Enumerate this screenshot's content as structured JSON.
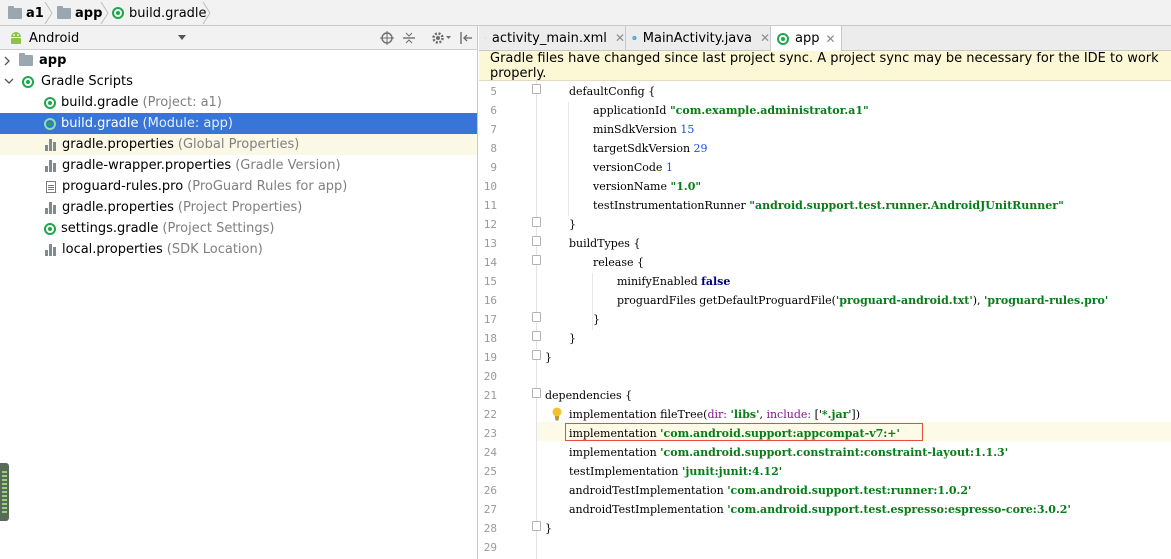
{
  "breadcrumb": [
    "a1",
    "app",
    "build.gradle"
  ],
  "project_view": {
    "selected_view": "Android"
  },
  "tree": [
    {
      "label": "app",
      "hint": ""
    },
    {
      "label": "Gradle Scripts",
      "hint": ""
    },
    {
      "label": "build.gradle",
      "hint": "(Project: a1)"
    },
    {
      "label": "build.gradle",
      "hint": "(Module: app)"
    },
    {
      "label": "gradle.properties",
      "hint": "(Global Properties)"
    },
    {
      "label": "gradle-wrapper.properties",
      "hint": "(Gradle Version)"
    },
    {
      "label": "proguard-rules.pro",
      "hint": "(ProGuard Rules for app)"
    },
    {
      "label": "gradle.properties",
      "hint": "(Project Properties)"
    },
    {
      "label": "settings.gradle",
      "hint": "(Project Settings)"
    },
    {
      "label": "local.properties",
      "hint": "(SDK Location)"
    }
  ],
  "tabs": [
    "activity_main.xml",
    "MainActivity.java",
    "app"
  ],
  "notice": "Gradle files have changed since last project sync. A project sync may be necessary for the IDE to work properly.",
  "line_numbers": [
    "5",
    "6",
    "7",
    "8",
    "9",
    "10",
    "11",
    "12",
    "13",
    "14",
    "15",
    "16",
    "17",
    "18",
    "19",
    "20",
    "21",
    "22",
    "23",
    "24",
    "25",
    "26",
    "27",
    "28",
    "29"
  ],
  "code": {
    "l5": "defaultConfig {",
    "l6a": "applicationId ",
    "l6b": "\"com.example.administrator.a1\"",
    "l7a": "minSdkVersion ",
    "l7b": "15",
    "l8a": "targetSdkVersion ",
    "l8b": "29",
    "l9a": "versionCode ",
    "l9b": "1",
    "l10a": "versionName ",
    "l10b": "\"1.0\"",
    "l11a": "testInstrumentationRunner ",
    "l11b": "\"android.support.test.runner.AndroidJUnitRunner\"",
    "l12": "}",
    "l13": "buildTypes {",
    "l14": "release {",
    "l15a": "minifyEnabled ",
    "l15b": "false",
    "l16a": "proguardFiles getDefaultProguardFile(",
    "l16b": "'proguard-android.txt'",
    "l16c": "), ",
    "l16d": "'proguard-rules.pro'",
    "l17": "}",
    "l18": "}",
    "l19": "}",
    "l21": "dependencies {",
    "l22a": "implementation fileTree(",
    "l22b": "dir: ",
    "l22c": "'libs'",
    "l22d": ", ",
    "l22e": "include: ",
    "l22f": "['",
    "l22g": "*.jar",
    "l22h": "'])",
    "l23a": "implementation ",
    "l23b": "'com.android.support:appcompat-v7:+'",
    "l24a": "implementation ",
    "l24b": "'com.android.support.constraint:constraint-layout:1.1.3'",
    "l25a": "testImplementation ",
    "l25b": "'junit:junit:4.12'",
    "l26a": "androidTestImplementation ",
    "l26b": "'com.android.support.test:runner:1.0.2'",
    "l27a": "androidTestImplementation ",
    "l27b": "'com.android.support.test.espresso:espresso-core:3.0.2'",
    "l28": "}"
  },
  "colors": {
    "selection": "#3875d7",
    "notice_bg": "#fcf7d4",
    "string": "#067d17",
    "number": "#1750eb",
    "highlight_box": "#e74c3c"
  }
}
